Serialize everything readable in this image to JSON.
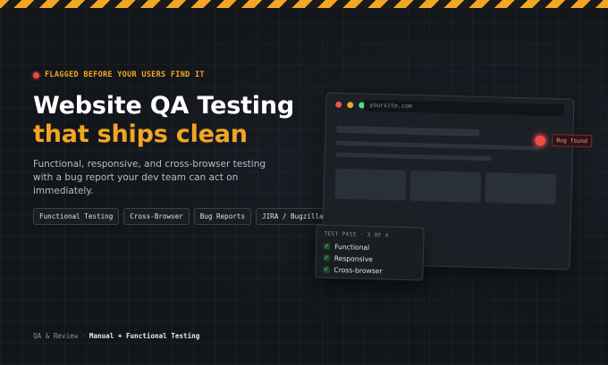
{
  "eyebrow": "FLAGGED BEFORE YOUR USERS FIND IT",
  "title": {
    "line1": "Website QA Testing",
    "line2": "that ships clean"
  },
  "subtitle": "Functional, responsive, and cross-browser testing with a bug report your dev team can act on immediately.",
  "tags": [
    "Functional Testing",
    "Cross-Browser",
    "Bug Reports",
    "JIRA / Bugzilla"
  ],
  "browser": {
    "url": "yoursite.com",
    "bug_label": "Bug found",
    "window_dots": [
      "#ef5350",
      "#f2a623",
      "#4ade80"
    ]
  },
  "checklist": {
    "title": "TEST PASS · 3 OF 4",
    "items": [
      "Functional",
      "Responsive",
      "Cross-browser"
    ]
  },
  "footer": {
    "category": "QA & Review",
    "separator": "·",
    "service": "Manual + Functional Testing"
  },
  "colors": {
    "accent": "#f2a623",
    "alert": "#ef4b4b",
    "success": "#4ade80",
    "background": "#121519"
  }
}
